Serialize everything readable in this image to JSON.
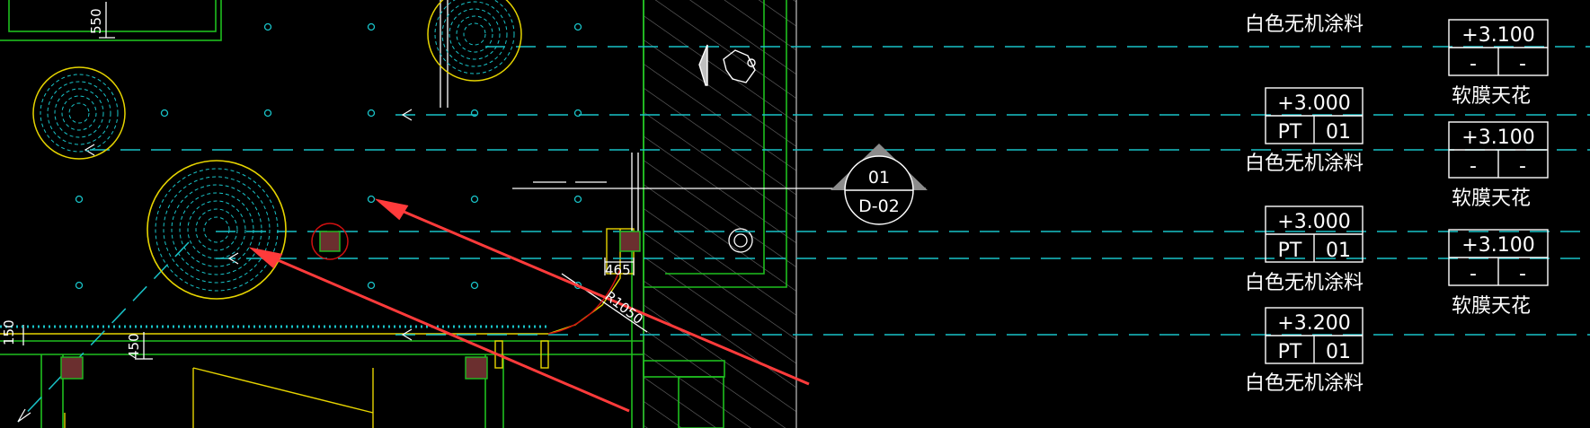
{
  "colors": {
    "background": "#000000",
    "cyan": "#19c3c8",
    "yellow": "#e6d400",
    "green": "#1fbf1f",
    "white": "#ffffff",
    "red_arrow": "#ff3b3b",
    "red_circle": "#d01010",
    "column_fill": "#6b2f2f",
    "hatch": "#6a6a6a"
  },
  "dimensions": {
    "d550": "550",
    "d150": "150",
    "d450": "450",
    "d465": "465",
    "r1050": "R1050"
  },
  "section_marker": {
    "top": "01",
    "bottom": "D-02"
  },
  "ceiling_tags": [
    {
      "elevation": "+3.100",
      "code": "-",
      "num": "-",
      "note": "软膜天花"
    },
    {
      "elevation": "+3.000",
      "code": "PT",
      "num": "01",
      "note": "白色无机涂料"
    },
    {
      "elevation": "+3.100",
      "code": "-",
      "num": "-",
      "note": "软膜天花"
    },
    {
      "elevation": "+3.000",
      "code": "PT",
      "num": "01",
      "note": "白色无机涂料"
    },
    {
      "elevation": "+3.100",
      "code": "-",
      "num": "-",
      "note": "软膜天花"
    },
    {
      "elevation": "+3.200",
      "code": "PT",
      "num": "01",
      "note": "白色无机涂料"
    }
  ],
  "top_note": "白色无机涂料"
}
